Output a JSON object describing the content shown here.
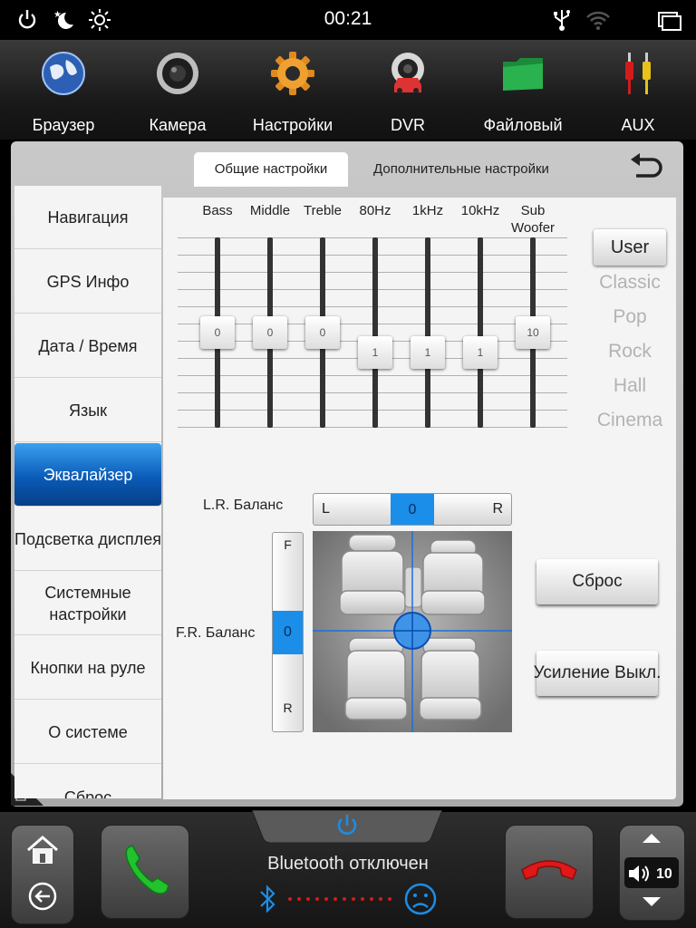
{
  "status_bar": {
    "time": "00:21",
    "icons": [
      "power-icon",
      "night-mode-icon",
      "brightness-icon",
      "usb-icon",
      "wifi-icon",
      "recent-apps-icon"
    ]
  },
  "apps": [
    {
      "label": "Браузер",
      "icon": "browser-globe-icon"
    },
    {
      "label": "Камера",
      "icon": "camera-lens-icon"
    },
    {
      "label": "Настройки",
      "icon": "gear-icon"
    },
    {
      "label": "DVR",
      "icon": "dvr-icon"
    },
    {
      "label": "Файловый",
      "icon": "folder-icon"
    },
    {
      "label": "AUX",
      "icon": "aux-cable-icon"
    }
  ],
  "tabs": {
    "general": "Общие настройки",
    "advanced": "Дополнительные настройки"
  },
  "sidebar": {
    "items": [
      {
        "label": "Навигация"
      },
      {
        "label": "GPS Инфо"
      },
      {
        "label": "Дата / Время"
      },
      {
        "label": "Язык"
      },
      {
        "label": "Эквалайзер",
        "active": true
      },
      {
        "label": "Подсветка дисплея"
      },
      {
        "label": "Системные настройки"
      },
      {
        "label": "Кнопки на руле"
      },
      {
        "label": "О системе"
      },
      {
        "label": "Сброс"
      }
    ]
  },
  "equalizer": {
    "range": [
      0,
      20
    ],
    "bands": [
      {
        "label": "Bass",
        "value": "0",
        "level": 10
      },
      {
        "label": "Middle",
        "value": "0",
        "level": 10
      },
      {
        "label": "Treble",
        "value": "0",
        "level": 10
      },
      {
        "label": "80Hz",
        "value": "1",
        "level": 7.9
      },
      {
        "label": "1kHz",
        "value": "1",
        "level": 7.9
      },
      {
        "label": "10kHz",
        "value": "1",
        "level": 7.9
      },
      {
        "label": "Sub Woofer",
        "value": "10",
        "level": 10
      }
    ],
    "presets": [
      "User",
      "Classic",
      "Pop",
      "Rock",
      "Hall",
      "Cinema"
    ],
    "active_preset": "User"
  },
  "balance": {
    "lr_label": "L.R. Баланс",
    "lr_left": "L",
    "lr_right": "R",
    "lr_value": "0",
    "fr_label": "F.R. Баланс",
    "fr_front": "F",
    "fr_rear": "R",
    "fr_value": "0"
  },
  "buttons": {
    "reset": "Сброс",
    "boost": "Усиление Выкл."
  },
  "dock": {
    "bluetooth_status": "Bluetooth отключен",
    "volume": "10"
  },
  "colors": {
    "accent_blue": "#1a8ee8",
    "active_item": "#0a5bb8",
    "call_green": "#22c22e",
    "hangup_red": "#e01818"
  }
}
